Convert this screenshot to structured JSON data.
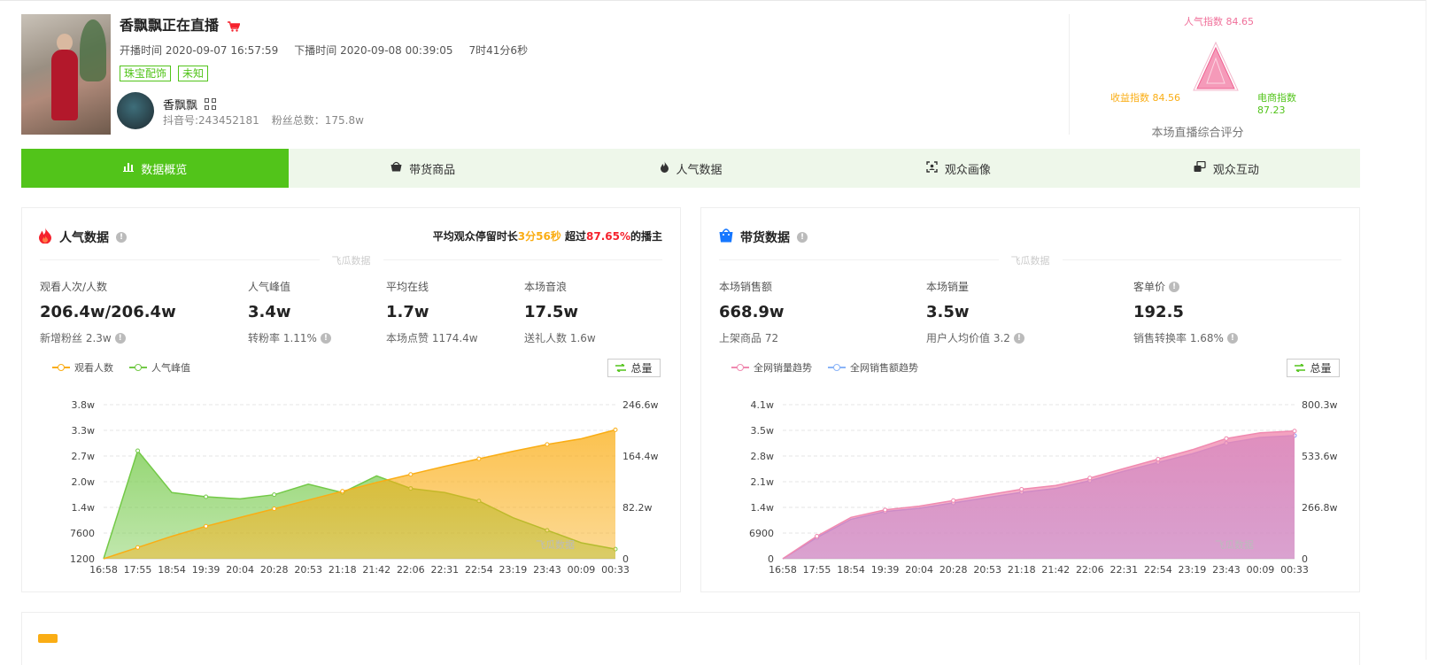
{
  "header": {
    "title": "香飘飘正在直播",
    "start_time": "开播时间 2020-09-07 16:57:59",
    "end_time": "下播时间 2020-09-08 00:39:05",
    "duration": "7时41分6秒",
    "tags": [
      "珠宝配饰",
      "未知"
    ],
    "anchor_name": "香飘飘",
    "douyin_id": "抖音号:243452181",
    "fans_total": "粉丝总数：175.8w"
  },
  "score": {
    "popularity": "人气指数 84.65",
    "revenue": "收益指数 84.56",
    "ecommerce": "电商指数 87.23",
    "caption": "本场直播综合评分",
    "colors": {
      "popularity": "#f0709a",
      "revenue": "#faad14",
      "ecommerce": "#52c41a"
    }
  },
  "tabs": [
    {
      "label": "数据概览",
      "icon": "bar-chart-icon",
      "active": true
    },
    {
      "label": "带货商品",
      "icon": "basket-icon",
      "active": false
    },
    {
      "label": "人气数据",
      "icon": "flame-icon",
      "active": false
    },
    {
      "label": "观众画像",
      "icon": "portrait-icon",
      "active": false
    },
    {
      "label": "观众互动",
      "icon": "interact-icon",
      "active": false
    }
  ],
  "popularity": {
    "title": "人气数据",
    "highlight_prefix": "平均观众停留时长",
    "highlight_time": "3分56秒",
    "highlight_mid": " 超过",
    "highlight_pct": "87.65%",
    "highlight_suffix": "的播主",
    "watermark": "飞瓜数据",
    "stats": [
      {
        "label": "观看人次/人数",
        "value": "206.4w/206.4w",
        "sub": "新增粉丝 2.3w",
        "info": true
      },
      {
        "label": "人气峰值",
        "value": "3.4w",
        "sub": "转粉率 1.11%",
        "info": true
      },
      {
        "label": "平均在线",
        "value": "1.7w",
        "sub": "本场点赞 1174.4w",
        "info": false
      },
      {
        "label": "本场音浪",
        "value": "17.5w",
        "sub": "送礼人数 1.6w",
        "info": false
      }
    ],
    "legend": [
      "观看人数",
      "人气峰值"
    ],
    "total_btn": "总量"
  },
  "sales": {
    "title": "带货数据",
    "watermark": "飞瓜数据",
    "stats": [
      {
        "label": "本场销售额",
        "value": "668.9w",
        "sub": "上架商品 72",
        "info": false
      },
      {
        "label": "本场销量",
        "value": "3.5w",
        "sub": "用户人均价值 3.2",
        "info": true
      },
      {
        "label": "客单价",
        "value": "192.5",
        "sub": "销售转换率 1.68%",
        "info": true,
        "label_info": true
      }
    ],
    "legend": [
      "全网销量趋势",
      "全网销售额趋势"
    ],
    "total_btn": "总量"
  },
  "chart_data": [
    {
      "type": "area",
      "x": [
        "16:58",
        "17:55",
        "18:54",
        "19:39",
        "20:04",
        "20:28",
        "20:53",
        "21:18",
        "21:42",
        "22:06",
        "22:31",
        "22:54",
        "23:19",
        "23:43",
        "00:09",
        "00:33"
      ],
      "y_left_ticks": [
        "1200",
        "7600",
        "1.4w",
        "2.0w",
        "2.7w",
        "3.3w",
        "3.8w"
      ],
      "y_right_ticks": [
        "0",
        "82.2w",
        "164.4w",
        "246.6w"
      ],
      "series": [
        {
          "name": "观看人数",
          "axis": "right",
          "color": "#faad14",
          "values": [
            0,
            18,
            36,
            52,
            66,
            80,
            94,
            108,
            122,
            135,
            148,
            160,
            172,
            183,
            192,
            206.4
          ]
        },
        {
          "name": "人气峰值",
          "axis": "left",
          "color": "#73c947",
          "values": [
            1200,
            27000,
            17000,
            16000,
            15500,
            16500,
            19000,
            17000,
            21000,
            18000,
            17000,
            15000,
            11000,
            8000,
            5000,
            3500
          ]
        }
      ],
      "watermark": "飞瓜数据"
    },
    {
      "type": "area",
      "x": [
        "16:58",
        "17:55",
        "18:54",
        "19:39",
        "20:04",
        "20:28",
        "20:53",
        "21:18",
        "21:42",
        "22:06",
        "22:31",
        "22:54",
        "23:19",
        "23:43",
        "00:09",
        "00:33"
      ],
      "y_left_ticks": [
        "0",
        "6900",
        "1.4w",
        "2.1w",
        "2.8w",
        "3.5w",
        "4.1w"
      ],
      "y_right_ticks": [
        "0",
        "266.8w",
        "533.6w",
        "800.3w"
      ],
      "series": [
        {
          "name": "全网销量趋势",
          "axis": "left",
          "color": "#f08ab0",
          "values": [
            0,
            6000,
            11000,
            13000,
            14000,
            15500,
            17000,
            18500,
            19500,
            21500,
            24000,
            26500,
            29000,
            32000,
            33500,
            34000
          ]
        },
        {
          "name": "全网销售额趋势",
          "axis": "right",
          "color": "#8b8cf0",
          "values": [
            0,
            110,
            205,
            245,
            262,
            290,
            318,
            345,
            365,
            405,
            455,
            500,
            545,
            600,
            630,
            640
          ]
        }
      ],
      "watermark": "飞瓜数据"
    }
  ]
}
